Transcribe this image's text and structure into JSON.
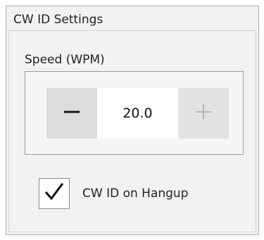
{
  "group": {
    "title": "CW ID Settings"
  },
  "speed": {
    "label": "Speed (WPM)",
    "value": "20.0",
    "decrement_icon": "minus-icon",
    "increment_icon": "plus-icon",
    "increment_enabled": false
  },
  "hangup": {
    "label": "CW ID on Hangup",
    "checked": true,
    "check_icon": "checkmark-icon"
  },
  "colors": {
    "panel_background": "#f2f2f2",
    "button_background": "#dcdcdc",
    "icon_enabled": "#1a1a1a",
    "icon_disabled": "#b5b5b5"
  }
}
